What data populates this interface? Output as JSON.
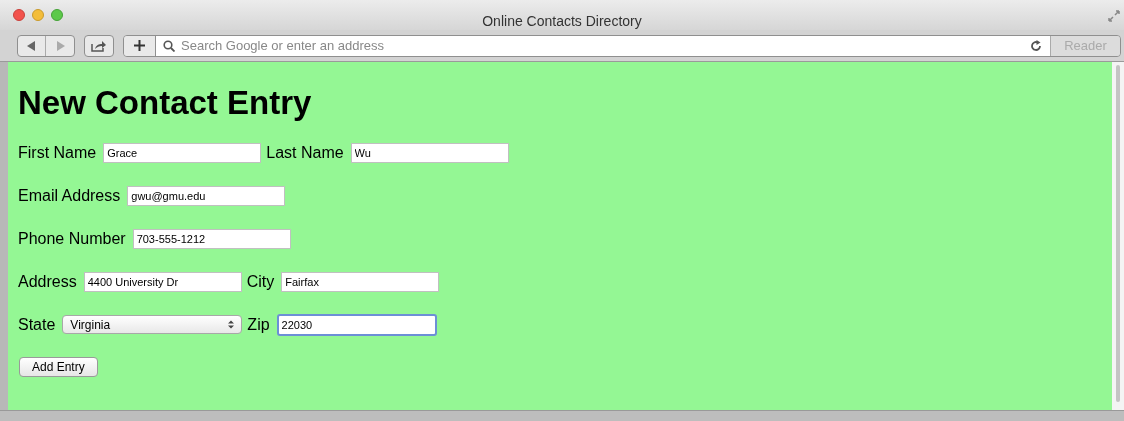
{
  "window": {
    "title": "Online Contacts Directory"
  },
  "toolbar": {
    "address_placeholder": "Search Google or enter an address",
    "reader_button": "Reader"
  },
  "page": {
    "heading": "New Contact Entry",
    "rows": [
      [
        {
          "label": "First Name",
          "kind": "text",
          "value": "Grace",
          "focused": false
        },
        {
          "label": "Last Name",
          "kind": "text",
          "value": "Wu",
          "focused": false
        }
      ],
      [
        {
          "label": "Email Address",
          "kind": "text",
          "value": "gwu@gmu.edu",
          "focused": false
        }
      ],
      [
        {
          "label": "Phone Number",
          "kind": "text",
          "value": "703-555-1212",
          "focused": false
        }
      ],
      [
        {
          "label": "Address",
          "kind": "text",
          "value": "4400 University Dr",
          "focused": false
        },
        {
          "label": "City",
          "kind": "text",
          "value": "Fairfax",
          "focused": false
        }
      ],
      [
        {
          "label": "State",
          "kind": "select",
          "value": "Virginia",
          "focused": false
        },
        {
          "label": "Zip",
          "kind": "text",
          "value": "22030",
          "focused": true
        }
      ]
    ],
    "submit_button": "Add Entry"
  }
}
